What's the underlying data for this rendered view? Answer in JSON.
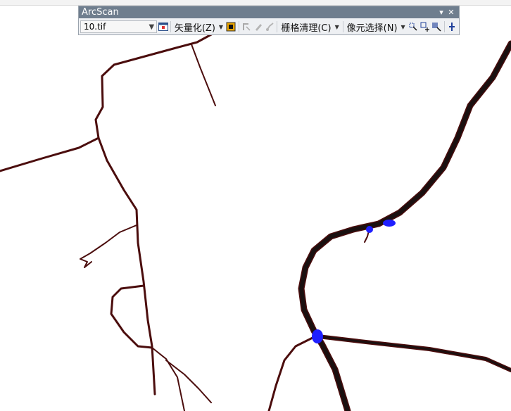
{
  "toolbar": {
    "title": "ArcScan",
    "minimize_glyph": "▾",
    "close_glyph": "✕",
    "raster_layer": {
      "value": "10.tif",
      "options": [
        "10.tif"
      ]
    },
    "menus": {
      "vectorization": "矢量化(Z)",
      "raster_cleanup": "栅格清理(C)",
      "cell_selection": "像元选择(N)"
    },
    "icons": [
      "raster-settings-icon",
      "vectorization-trace-icon",
      "vector-preview-icon",
      "pencil-icon",
      "raster-painting-icon",
      "select-connected-cells-icon",
      "interactive-selection-target-icon",
      "cell-selection-erase-icon",
      "raster-snapping-icon"
    ]
  },
  "colors": {
    "road_outline": "#4b0d0d",
    "road_fill": "#1a1010",
    "selection_blue": "#1f1fff",
    "toolbar_title_bg": "#6f7e8e",
    "toolbar_bg": "#eef0f3"
  }
}
